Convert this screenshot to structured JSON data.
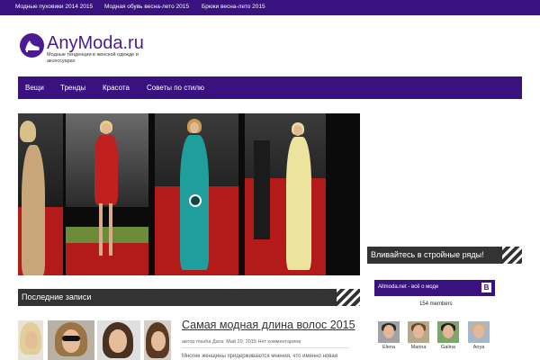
{
  "topbar": {
    "links": [
      "Модные пуховики 2014 2015",
      "Модная обувь весна-лето 2015",
      "Брюки весна-лето 2015"
    ]
  },
  "logo": {
    "name": "AnyModa.ru",
    "tagline": "Модные тенденции в женской одежде и аксессуарах"
  },
  "nav": {
    "items": [
      "Вещи",
      "Тренды",
      "Красота",
      "Советы по стилю"
    ]
  },
  "sections": {
    "latest": "Последние записи",
    "join": "Вливайтесь в стройные ряды!"
  },
  "post": {
    "title": "Самая модная длина волос 2015",
    "meta": "автор masha Дата: Май 29, 2015 Нет комментариев",
    "excerpt": "Многие женщины придерживаются мнения, что именно новая"
  },
  "widget": {
    "group_name": "Allmoda.net - всё о моде",
    "logo_letter": "В",
    "members_count": "154 members",
    "members": [
      "Elena",
      "Marina",
      "Galina",
      "Anya"
    ]
  },
  "colors": {
    "brand": "#3a1280",
    "section_bar": "#333333",
    "carpet": "#b31a1a"
  }
}
